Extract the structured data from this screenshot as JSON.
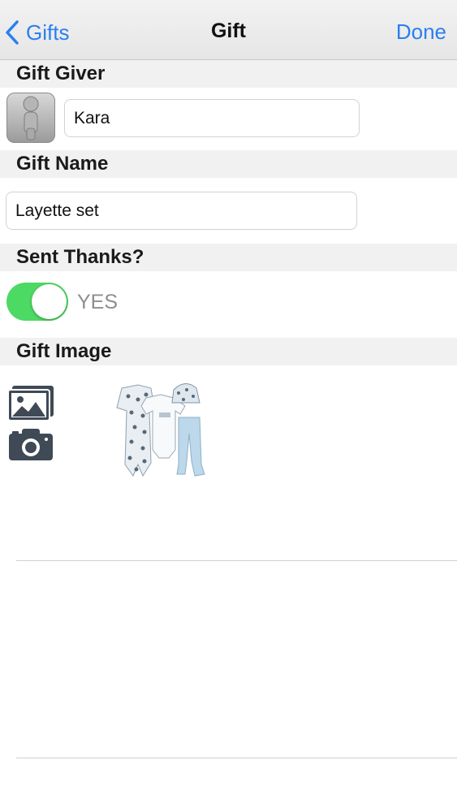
{
  "nav": {
    "back_label": "Gifts",
    "title": "Gift",
    "done_label": "Done"
  },
  "sections": {
    "giver": "Gift Giver",
    "name": "Gift Name",
    "thanks": "Sent Thanks?",
    "image": "Gift Image"
  },
  "giver_field": {
    "value": "Kara"
  },
  "name_field": {
    "value": "Layette set"
  },
  "thanks_toggle": {
    "on": true,
    "label": "YES"
  },
  "colors": {
    "accent": "#2a7ff0",
    "toggle_on": "#4cd964"
  },
  "icons": {
    "back": "chevron-left-icon",
    "avatar": "person-icon",
    "gallery": "photo-library-icon",
    "camera": "camera-icon"
  }
}
